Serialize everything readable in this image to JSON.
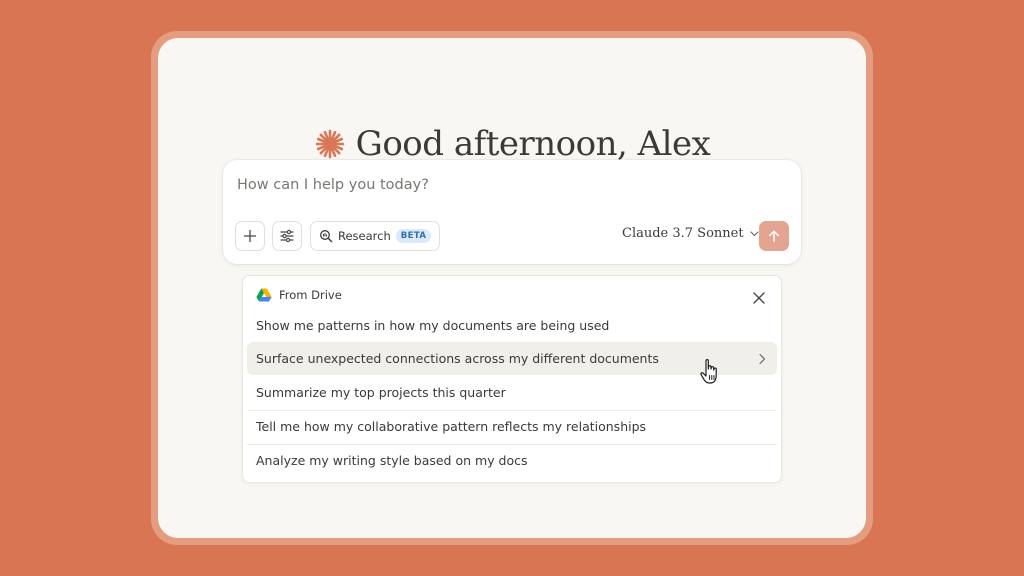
{
  "greeting": "Good afternoon, Alex",
  "composer": {
    "placeholder": "How can I help you today?",
    "research_label": "Research",
    "research_badge": "BETA",
    "model_name": "Claude 3.7 Sonnet"
  },
  "suggestions": {
    "source": "From Drive",
    "items": [
      "Show me patterns in how my documents are being used",
      "Surface unexpected connections across my different documents",
      "Summarize my top projects this quarter",
      "Tell me how my collaborative pattern reflects my relationships",
      "Analyze my writing style based on my docs"
    ],
    "hovered_index": 1
  },
  "colors": {
    "background": "#d87654",
    "accent": "#d97757",
    "send_button": "#e3a591",
    "beta_badge": "#dbeaf8"
  },
  "icons": [
    "claude-star-icon",
    "plus-icon",
    "sliders-icon",
    "research-icon",
    "chevron-down-icon",
    "arrow-up-icon",
    "google-drive-icon",
    "close-icon",
    "chevron-right-icon",
    "hand-pointer-cursor"
  ]
}
